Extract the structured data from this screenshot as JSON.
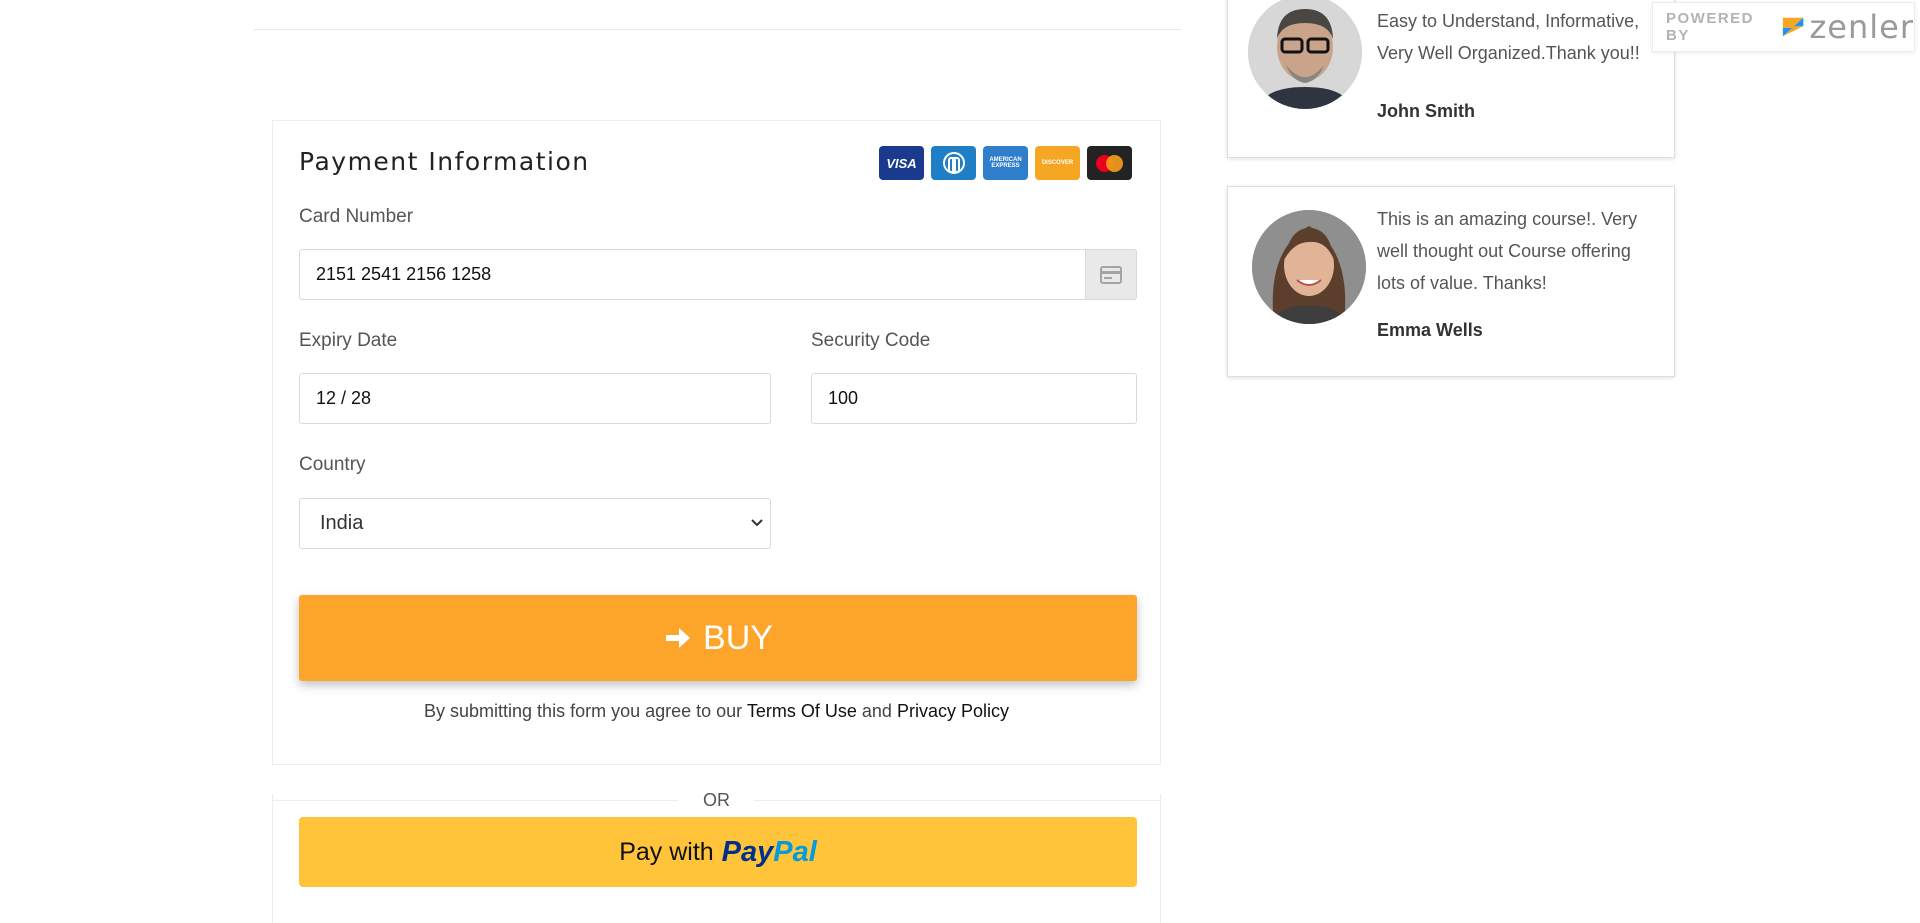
{
  "payment": {
    "title": "Payment Information",
    "card_brands": [
      "visa",
      "diners-club",
      "american-express",
      "discover",
      "mastercard"
    ],
    "card_brand_text": {
      "visa": "VISA",
      "amex": "AMERICAN EXPRESS",
      "discover": "DISCOVER"
    },
    "card_number_label": "Card Number",
    "card_number_value": "2151 2541 2156 1258",
    "expiry_label": "Expiry Date",
    "expiry_value": "12 / 28",
    "security_label": "Security Code",
    "security_value": "100",
    "country_label": "Country",
    "country_value": "India",
    "buy_label": "BUY",
    "terms_prefix": "By submitting this form you agree to our",
    "terms_link": "Terms Of Use",
    "terms_and": "and",
    "privacy_link": "Privacy Policy",
    "or_label": "OR",
    "paypal_prefix": "Pay with",
    "paypal_brand_1": "Pay",
    "paypal_brand_2": "Pal"
  },
  "testimonials": [
    {
      "quote": "Highly Recommended Course. Easy to Understand, Informative, Very Well Organized.Thank you!!",
      "name": "John Smith"
    },
    {
      "quote": "This is an amazing course!. Very well thought out Course offering lots of value. Thanks!",
      "name": "Emma Wells"
    }
  ],
  "badge": {
    "powered_by": "POWERED BY",
    "brand": "zenler"
  },
  "colors": {
    "buy_button": "#fda42b",
    "paypal_button": "#ffc439",
    "paypal_dark_blue": "#003087",
    "paypal_light_blue": "#009cde"
  },
  "icons": {
    "buy": "arrow-right-icon",
    "card_field": "credit-card-icon",
    "select": "chevron-down-icon",
    "badge": "zenler-logo-icon"
  }
}
